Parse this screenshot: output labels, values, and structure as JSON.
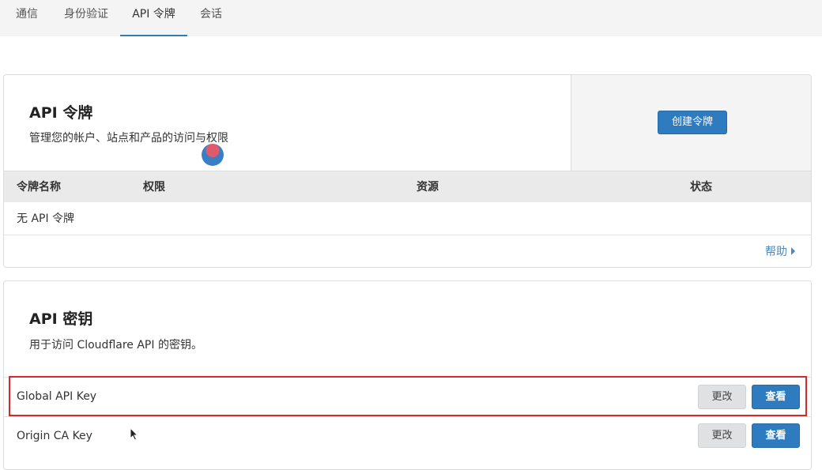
{
  "tabs": [
    "通信",
    "身份验证",
    "API 令牌",
    "会话"
  ],
  "active_tab": "API 令牌",
  "tokens": {
    "title": "API 令牌",
    "description": "管理您的帐户、站点和产品的访问与权限",
    "create_button": "创建令牌",
    "columns": [
      "令牌名称",
      "权限",
      "资源",
      "状态"
    ],
    "empty_text": "无 API 令牌",
    "help_label": "帮助"
  },
  "keys": {
    "title": "API 密钥",
    "description": "用于访问 Cloudflare API 的密钥。",
    "rows": [
      {
        "label": "Global API Key",
        "change": "更改",
        "view": "查看"
      },
      {
        "label": "Origin CA Key",
        "change": "更改",
        "view": "查看"
      }
    ]
  },
  "colors": {
    "primary": "#2f7bbf",
    "highlight": "#d42a2a"
  }
}
